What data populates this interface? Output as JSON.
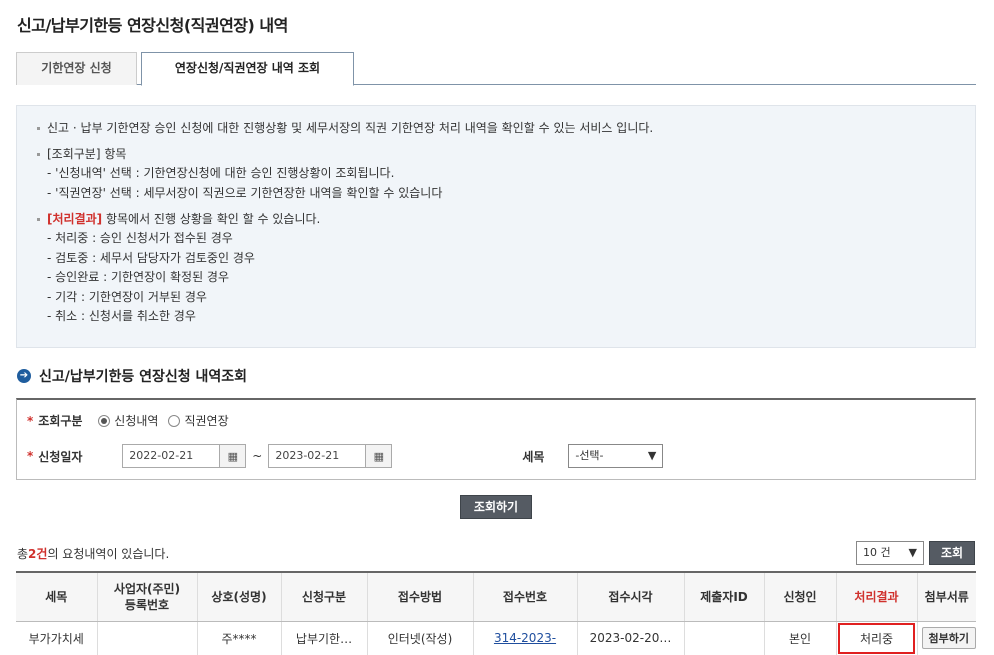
{
  "title": "신고/납부기한등 연장신청(직권연장) 내역",
  "tabs": [
    {
      "label": "기한연장 신청"
    },
    {
      "label": "연장신청/직권연장 내역 조회"
    }
  ],
  "info": {
    "line1": "신고 · 납부 기한연장 승인 신청에 대한 진행상황 및 세무서장의 직권 기한연장 처리 내역을 확인할 수 있는 서비스 입니다.",
    "group_label": "[조회구분] 항목",
    "sub1": "- '신청내역' 선택 : 기한연장신청에 대한 승인 진행상황이 조회됩니다.",
    "sub2": "- '직권연장' 선택 : 세무서장이 직권으로 기한연장한 내역을 확인할 수 있습니다",
    "result_key": "[처리결과]",
    "result_rest": " 항목에서 진행 상황을 확인 할 수 있습니다.",
    "results": [
      "- 처리중 : 승인 신청서가 접수된 경우",
      "- 검토중 : 세무서 담당자가 검토중인 경우",
      "- 승인완료 : 기한연장이 확정된 경우",
      "- 기각 : 기한연장이 거부된 경우",
      "- 취소 : 신청서를 취소한 경우"
    ]
  },
  "section_title": "신고/납부기한등 연장신청 내역조회",
  "search": {
    "type_label": "조회구분",
    "opt1": "신청내역",
    "opt2": "직권연장",
    "date_label": "신청일자",
    "date_from": "2022-02-21",
    "date_to": "2023-02-21",
    "tilde": "~",
    "tax_label": "세목",
    "tax_value": "-선택-",
    "button": "조회하기"
  },
  "list": {
    "count_prefix": "총",
    "count": "2건",
    "count_suffix": "의 요청내역이 있습니다.",
    "pagesize": "10 건",
    "lookup": "조회"
  },
  "table": {
    "headers": [
      "세목",
      "사업자(주민)\n등록번호",
      "상호(성명)",
      "신청구분",
      "접수방법",
      "접수번호",
      "접수시각",
      "제출자ID",
      "신청인",
      "처리결과",
      "첨부서류"
    ],
    "rows": [
      [
        "부가가치세",
        "",
        "주****",
        "납부기한…",
        "인터넷(작성)",
        "314-2023-",
        "2023-02-20…",
        "",
        "본인",
        "처리중",
        "첨부하기"
      ]
    ]
  },
  "colors": {
    "accent_red": "#d0312d",
    "highlight": "#e02020",
    "button_dark": "#555b63"
  }
}
